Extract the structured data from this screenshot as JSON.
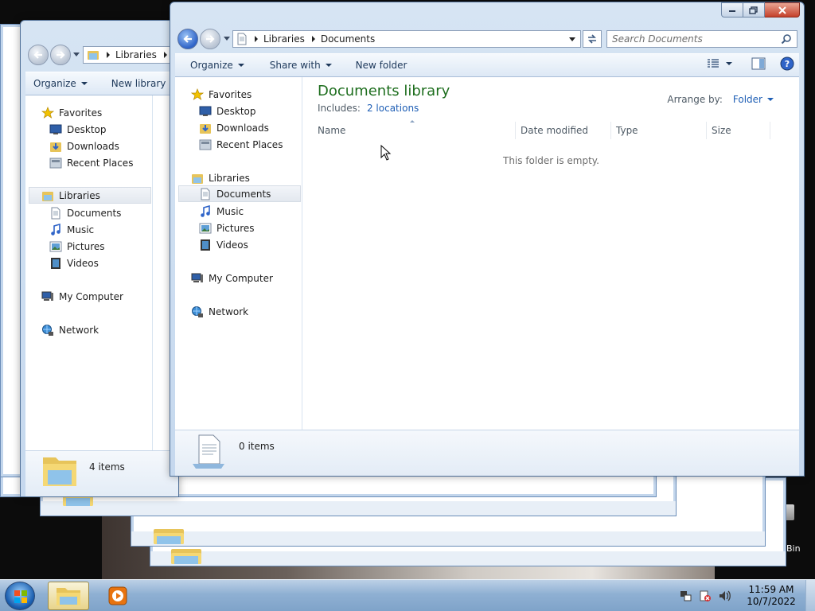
{
  "desktop": {
    "recycle_bin_label": "Bin"
  },
  "back_window": {
    "address": {
      "crumbs": [
        "Libraries"
      ]
    },
    "commands": {
      "organize": "Organize",
      "new_library": "New library"
    },
    "nav": {
      "favorites": "Favorites",
      "favorites_items": [
        "Desktop",
        "Downloads",
        "Recent Places"
      ],
      "libraries": "Libraries",
      "libraries_items": [
        "Documents",
        "Music",
        "Pictures",
        "Videos"
      ],
      "computer": "My Computer",
      "network": "Network"
    },
    "status": {
      "count": "4 items"
    }
  },
  "front_window": {
    "address": {
      "crumbs": [
        "Libraries",
        "Documents"
      ]
    },
    "search": {
      "placeholder": "Search Documents"
    },
    "commands": {
      "organize": "Organize",
      "share_with": "Share with",
      "new_folder": "New folder"
    },
    "nav": {
      "favorites": "Favorites",
      "favorites_items": [
        "Desktop",
        "Downloads",
        "Recent Places"
      ],
      "libraries": "Libraries",
      "libraries_items": [
        "Documents",
        "Music",
        "Pictures",
        "Videos"
      ],
      "selected": "Documents",
      "computer": "My Computer",
      "network": "Network"
    },
    "content": {
      "title": "Documents library",
      "includes_label": "Includes:",
      "includes_link": "2 locations",
      "arrange_label": "Arrange by:",
      "arrange_value": "Folder",
      "columns": [
        "Name",
        "Date modified",
        "Type",
        "Size"
      ],
      "empty_message": "This folder is empty."
    },
    "status": {
      "count": "0 items"
    }
  },
  "taskbar": {
    "clock": {
      "time": "11:59 AM",
      "date": "10/7/2022"
    }
  },
  "icons": {
    "back": "back-arrow-icon",
    "forward": "forward-arrow-icon",
    "search": "search-icon",
    "refresh": "refresh-icon",
    "views": "view-options-icon",
    "preview": "preview-pane-icon",
    "help": "help-icon",
    "start": "windows-start-icon"
  },
  "colors": {
    "library_title": "#1e6e1e",
    "link": "#1f5fb5",
    "taskbar": "#8fb0d3"
  }
}
